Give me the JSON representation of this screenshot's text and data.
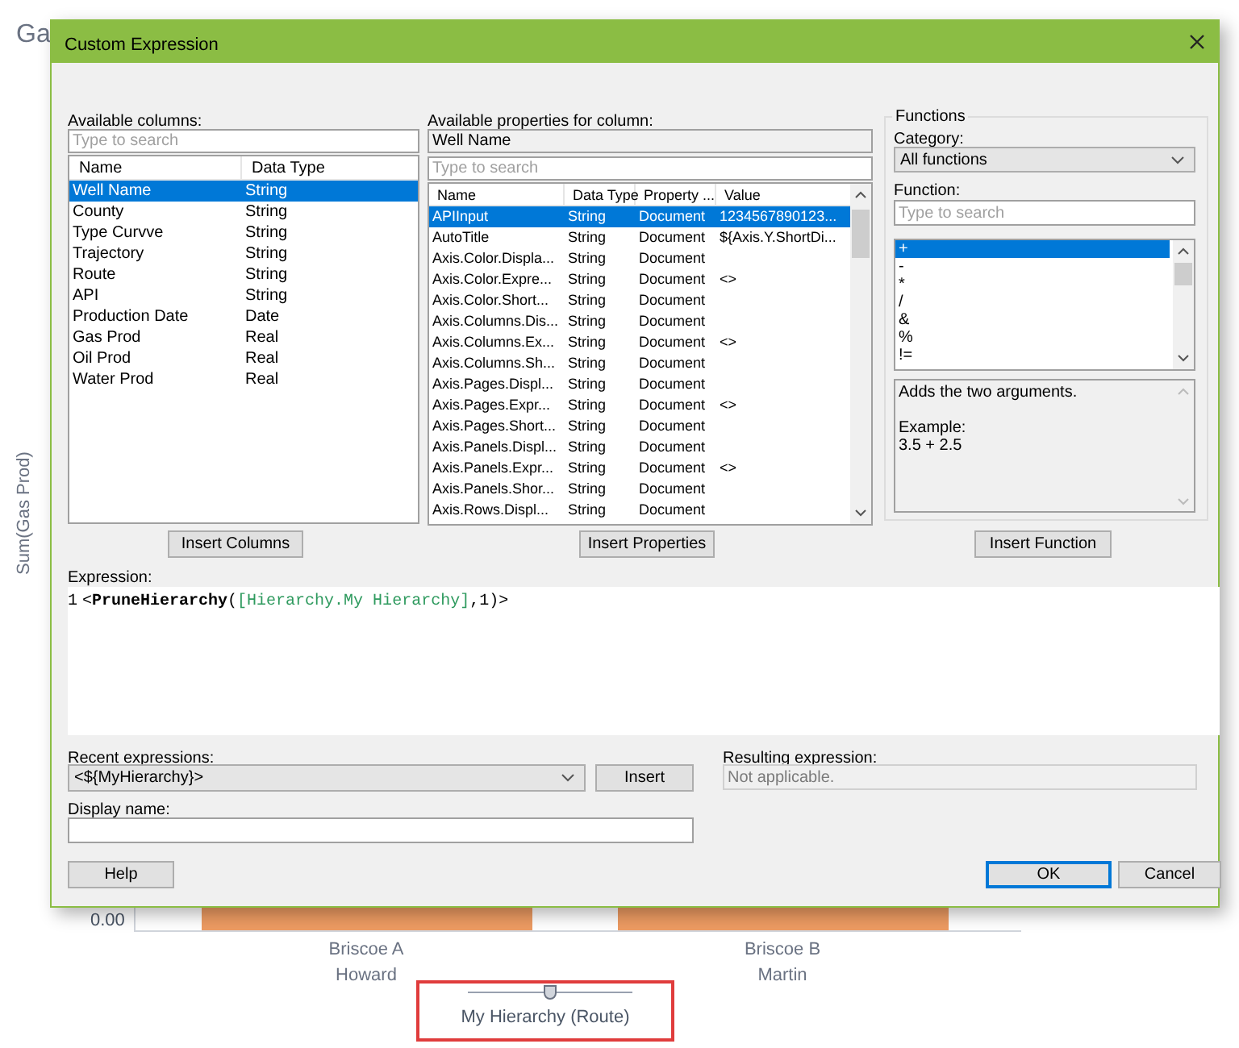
{
  "chart": {
    "title": "Ga",
    "y_axis_label": "Sum(Gas Prod)",
    "y_tick": "0.00",
    "categories": [
      {
        "name": "Briscoe A",
        "parent": "Howard"
      },
      {
        "name": "Briscoe B",
        "parent": "Martin"
      }
    ],
    "hierarchy_slider": {
      "label": "My Hierarchy (Route)",
      "level": 0.5
    }
  },
  "dialog": {
    "title": "Custom Expression",
    "available_columns": {
      "label": "Available columns:",
      "search_placeholder": "Type to search",
      "columns": [
        "Name",
        "Data Type"
      ],
      "rows": [
        {
          "name": "Well Name",
          "type": "String",
          "selected": true
        },
        {
          "name": "County",
          "type": "String",
          "selected": false
        },
        {
          "name": "Type Curvve",
          "type": "String",
          "selected": false
        },
        {
          "name": "Trajectory",
          "type": "String",
          "selected": false
        },
        {
          "name": "Route",
          "type": "String",
          "selected": false
        },
        {
          "name": "API",
          "type": "String",
          "selected": false
        },
        {
          "name": "Production Date",
          "type": "Date",
          "selected": false
        },
        {
          "name": "Gas Prod",
          "type": "Real",
          "selected": false
        },
        {
          "name": "Oil Prod",
          "type": "Real",
          "selected": false
        },
        {
          "name": "Water Prod",
          "type": "Real",
          "selected": false
        }
      ],
      "button": "Insert Columns"
    },
    "properties": {
      "label": "Available properties for column:",
      "column": "Well Name",
      "search_placeholder": "Type to search",
      "columns": [
        "Name",
        "Data Type",
        "Property ...",
        "Value"
      ],
      "rows": [
        {
          "cells": [
            "APIInput",
            "String",
            "Document",
            "1234567890123..."
          ],
          "selected": true
        },
        {
          "cells": [
            "AutoTitle",
            "String",
            "Document",
            "${Axis.Y.ShortDi..."
          ],
          "selected": false
        },
        {
          "cells": [
            "Axis.Color.Displa...",
            "String",
            "Document",
            ""
          ],
          "selected": false
        },
        {
          "cells": [
            "Axis.Color.Expre...",
            "String",
            "Document",
            "<>"
          ],
          "selected": false
        },
        {
          "cells": [
            "Axis.Color.Short...",
            "String",
            "Document",
            ""
          ],
          "selected": false
        },
        {
          "cells": [
            "Axis.Columns.Dis...",
            "String",
            "Document",
            ""
          ],
          "selected": false
        },
        {
          "cells": [
            "Axis.Columns.Ex...",
            "String",
            "Document",
            "<>"
          ],
          "selected": false
        },
        {
          "cells": [
            "Axis.Columns.Sh...",
            "String",
            "Document",
            ""
          ],
          "selected": false
        },
        {
          "cells": [
            "Axis.Pages.Displ...",
            "String",
            "Document",
            ""
          ],
          "selected": false
        },
        {
          "cells": [
            "Axis.Pages.Expr...",
            "String",
            "Document",
            "<>"
          ],
          "selected": false
        },
        {
          "cells": [
            "Axis.Pages.Short...",
            "String",
            "Document",
            ""
          ],
          "selected": false
        },
        {
          "cells": [
            "Axis.Panels.Displ...",
            "String",
            "Document",
            ""
          ],
          "selected": false
        },
        {
          "cells": [
            "Axis.Panels.Expr...",
            "String",
            "Document",
            "<>"
          ],
          "selected": false
        },
        {
          "cells": [
            "Axis.Panels.Shor...",
            "String",
            "Document",
            ""
          ],
          "selected": false
        },
        {
          "cells": [
            "Axis.Rows.Displ...",
            "String",
            "Document",
            ""
          ],
          "selected": false
        }
      ],
      "button": "Insert Properties"
    },
    "functions": {
      "group_title": "Functions",
      "category_label": "Category:",
      "category": "All functions",
      "function_label": "Function:",
      "search_placeholder": "Type to search",
      "items": [
        {
          "text": "+",
          "selected": true
        },
        {
          "text": "-",
          "selected": false
        },
        {
          "text": "*",
          "selected": false
        },
        {
          "text": "/",
          "selected": false
        },
        {
          "text": "&",
          "selected": false
        },
        {
          "text": "%",
          "selected": false
        },
        {
          "text": "!=",
          "selected": false
        }
      ],
      "description": [
        "Adds the two arguments.",
        "Example:",
        "3.5 + 2.5"
      ],
      "button": "Insert Function"
    },
    "expression": {
      "label": "Expression:",
      "line_number": "1",
      "segments": [
        {
          "kind": "plain",
          "text": "<"
        },
        {
          "kind": "function",
          "text": "PruneHierarchy"
        },
        {
          "kind": "plain",
          "text": "("
        },
        {
          "kind": "column",
          "text": "[Hierarchy.My Hierarchy]"
        },
        {
          "kind": "plain",
          "text": ",1)>"
        }
      ]
    },
    "recent": {
      "label": "Recent expressions:",
      "value": "<${MyHierarchy}>",
      "button": "Insert"
    },
    "resulting": {
      "label": "Resulting expression:",
      "value": "Not applicable."
    },
    "display_name": {
      "label": "Display name:"
    },
    "buttons": [
      {
        "label": "Help",
        "default": false
      },
      {
        "label": "OK",
        "default": true
      },
      {
        "label": "Cancel",
        "default": false
      }
    ]
  }
}
